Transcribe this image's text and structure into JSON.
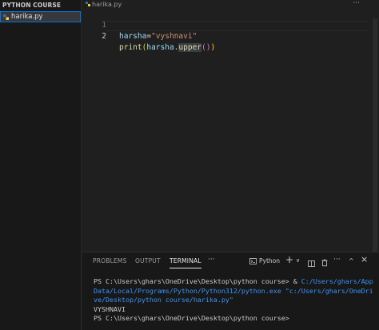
{
  "sidebar": {
    "header": "PYTHON COURSE",
    "files": [
      {
        "name": "harika.py",
        "selected": true
      }
    ]
  },
  "editor": {
    "tab": {
      "label": "harika.py"
    },
    "menu_label": "···",
    "lines": [
      {
        "number": "1",
        "tokens": [
          "harsha",
          "=",
          "\"vyshnavi\""
        ]
      },
      {
        "number": "2",
        "tokens": [
          "print",
          "(",
          "harsha",
          ".",
          "upper",
          "()",
          ")"
        ]
      }
    ]
  },
  "panel": {
    "tabs": [
      "PROBLEMS",
      "OUTPUT",
      "TERMINAL"
    ],
    "active_tab": "TERMINAL",
    "more_label": "···",
    "shell_label": "Python",
    "controls": {
      "add": "+",
      "dropdown": "∨",
      "split": "⊡",
      "trash": "🗑",
      "more": "···",
      "maximize": "^",
      "close": "×"
    },
    "terminal": {
      "line1_prompt": "PS C:\\Users\\ghars\\OneDrive\\Desktop\\python course> & ",
      "line1_link": "C:/Users/ghars/App",
      "line2_link": "Data/Local/Programs/Python/Python312/python.exe",
      "line2_str": " \"c:/Users/ghars/OneDri",
      "line3_str": "ve/Desktop/python course/harika.py\"",
      "output": "VYSHNAVI",
      "line5_prompt": "PS C:\\Users\\ghars\\OneDrive\\Desktop\\python course>"
    }
  },
  "colors": {
    "accent": "#0078d4",
    "string": "#ce9178",
    "variable": "#9cdcfe",
    "function": "#dcdcaa"
  }
}
